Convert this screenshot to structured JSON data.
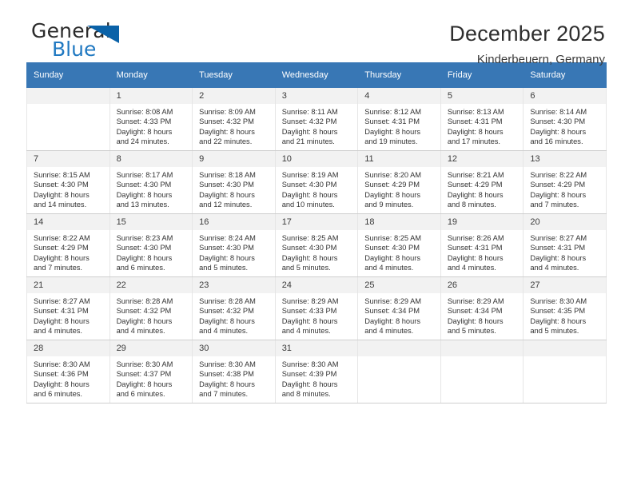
{
  "brand": {
    "name_top": "General",
    "name_bottom": "Blue",
    "triangle_color": "#0a62a8",
    "accent_color": "#1f78c1"
  },
  "header": {
    "title": "December 2025",
    "subtitle": "Kinderbeuern, Germany"
  },
  "calendar": {
    "header_bg": "#3877b5",
    "weekdays": [
      "Sunday",
      "Monday",
      "Tuesday",
      "Wednesday",
      "Thursday",
      "Friday",
      "Saturday"
    ],
    "weeks": [
      [
        {
          "day": "",
          "sunrise": "",
          "sunset": "",
          "daylight_1": "",
          "daylight_2": "",
          "empty": true
        },
        {
          "day": "1",
          "sunrise": "Sunrise: 8:08 AM",
          "sunset": "Sunset: 4:33 PM",
          "daylight_1": "Daylight: 8 hours",
          "daylight_2": "and 24 minutes."
        },
        {
          "day": "2",
          "sunrise": "Sunrise: 8:09 AM",
          "sunset": "Sunset: 4:32 PM",
          "daylight_1": "Daylight: 8 hours",
          "daylight_2": "and 22 minutes."
        },
        {
          "day": "3",
          "sunrise": "Sunrise: 8:11 AM",
          "sunset": "Sunset: 4:32 PM",
          "daylight_1": "Daylight: 8 hours",
          "daylight_2": "and 21 minutes."
        },
        {
          "day": "4",
          "sunrise": "Sunrise: 8:12 AM",
          "sunset": "Sunset: 4:31 PM",
          "daylight_1": "Daylight: 8 hours",
          "daylight_2": "and 19 minutes."
        },
        {
          "day": "5",
          "sunrise": "Sunrise: 8:13 AM",
          "sunset": "Sunset: 4:31 PM",
          "daylight_1": "Daylight: 8 hours",
          "daylight_2": "and 17 minutes."
        },
        {
          "day": "6",
          "sunrise": "Sunrise: 8:14 AM",
          "sunset": "Sunset: 4:30 PM",
          "daylight_1": "Daylight: 8 hours",
          "daylight_2": "and 16 minutes."
        }
      ],
      [
        {
          "day": "7",
          "sunrise": "Sunrise: 8:15 AM",
          "sunset": "Sunset: 4:30 PM",
          "daylight_1": "Daylight: 8 hours",
          "daylight_2": "and 14 minutes."
        },
        {
          "day": "8",
          "sunrise": "Sunrise: 8:17 AM",
          "sunset": "Sunset: 4:30 PM",
          "daylight_1": "Daylight: 8 hours",
          "daylight_2": "and 13 minutes."
        },
        {
          "day": "9",
          "sunrise": "Sunrise: 8:18 AM",
          "sunset": "Sunset: 4:30 PM",
          "daylight_1": "Daylight: 8 hours",
          "daylight_2": "and 12 minutes."
        },
        {
          "day": "10",
          "sunrise": "Sunrise: 8:19 AM",
          "sunset": "Sunset: 4:30 PM",
          "daylight_1": "Daylight: 8 hours",
          "daylight_2": "and 10 minutes."
        },
        {
          "day": "11",
          "sunrise": "Sunrise: 8:20 AM",
          "sunset": "Sunset: 4:29 PM",
          "daylight_1": "Daylight: 8 hours",
          "daylight_2": "and 9 minutes."
        },
        {
          "day": "12",
          "sunrise": "Sunrise: 8:21 AM",
          "sunset": "Sunset: 4:29 PM",
          "daylight_1": "Daylight: 8 hours",
          "daylight_2": "and 8 minutes."
        },
        {
          "day": "13",
          "sunrise": "Sunrise: 8:22 AM",
          "sunset": "Sunset: 4:29 PM",
          "daylight_1": "Daylight: 8 hours",
          "daylight_2": "and 7 minutes."
        }
      ],
      [
        {
          "day": "14",
          "sunrise": "Sunrise: 8:22 AM",
          "sunset": "Sunset: 4:29 PM",
          "daylight_1": "Daylight: 8 hours",
          "daylight_2": "and 7 minutes."
        },
        {
          "day": "15",
          "sunrise": "Sunrise: 8:23 AM",
          "sunset": "Sunset: 4:30 PM",
          "daylight_1": "Daylight: 8 hours",
          "daylight_2": "and 6 minutes."
        },
        {
          "day": "16",
          "sunrise": "Sunrise: 8:24 AM",
          "sunset": "Sunset: 4:30 PM",
          "daylight_1": "Daylight: 8 hours",
          "daylight_2": "and 5 minutes."
        },
        {
          "day": "17",
          "sunrise": "Sunrise: 8:25 AM",
          "sunset": "Sunset: 4:30 PM",
          "daylight_1": "Daylight: 8 hours",
          "daylight_2": "and 5 minutes."
        },
        {
          "day": "18",
          "sunrise": "Sunrise: 8:25 AM",
          "sunset": "Sunset: 4:30 PM",
          "daylight_1": "Daylight: 8 hours",
          "daylight_2": "and 4 minutes."
        },
        {
          "day": "19",
          "sunrise": "Sunrise: 8:26 AM",
          "sunset": "Sunset: 4:31 PM",
          "daylight_1": "Daylight: 8 hours",
          "daylight_2": "and 4 minutes."
        },
        {
          "day": "20",
          "sunrise": "Sunrise: 8:27 AM",
          "sunset": "Sunset: 4:31 PM",
          "daylight_1": "Daylight: 8 hours",
          "daylight_2": "and 4 minutes."
        }
      ],
      [
        {
          "day": "21",
          "sunrise": "Sunrise: 8:27 AM",
          "sunset": "Sunset: 4:31 PM",
          "daylight_1": "Daylight: 8 hours",
          "daylight_2": "and 4 minutes."
        },
        {
          "day": "22",
          "sunrise": "Sunrise: 8:28 AM",
          "sunset": "Sunset: 4:32 PM",
          "daylight_1": "Daylight: 8 hours",
          "daylight_2": "and 4 minutes."
        },
        {
          "day": "23",
          "sunrise": "Sunrise: 8:28 AM",
          "sunset": "Sunset: 4:32 PM",
          "daylight_1": "Daylight: 8 hours",
          "daylight_2": "and 4 minutes."
        },
        {
          "day": "24",
          "sunrise": "Sunrise: 8:29 AM",
          "sunset": "Sunset: 4:33 PM",
          "daylight_1": "Daylight: 8 hours",
          "daylight_2": "and 4 minutes."
        },
        {
          "day": "25",
          "sunrise": "Sunrise: 8:29 AM",
          "sunset": "Sunset: 4:34 PM",
          "daylight_1": "Daylight: 8 hours",
          "daylight_2": "and 4 minutes."
        },
        {
          "day": "26",
          "sunrise": "Sunrise: 8:29 AM",
          "sunset": "Sunset: 4:34 PM",
          "daylight_1": "Daylight: 8 hours",
          "daylight_2": "and 5 minutes."
        },
        {
          "day": "27",
          "sunrise": "Sunrise: 8:30 AM",
          "sunset": "Sunset: 4:35 PM",
          "daylight_1": "Daylight: 8 hours",
          "daylight_2": "and 5 minutes."
        }
      ],
      [
        {
          "day": "28",
          "sunrise": "Sunrise: 8:30 AM",
          "sunset": "Sunset: 4:36 PM",
          "daylight_1": "Daylight: 8 hours",
          "daylight_2": "and 6 minutes."
        },
        {
          "day": "29",
          "sunrise": "Sunrise: 8:30 AM",
          "sunset": "Sunset: 4:37 PM",
          "daylight_1": "Daylight: 8 hours",
          "daylight_2": "and 6 minutes."
        },
        {
          "day": "30",
          "sunrise": "Sunrise: 8:30 AM",
          "sunset": "Sunset: 4:38 PM",
          "daylight_1": "Daylight: 8 hours",
          "daylight_2": "and 7 minutes."
        },
        {
          "day": "31",
          "sunrise": "Sunrise: 8:30 AM",
          "sunset": "Sunset: 4:39 PM",
          "daylight_1": "Daylight: 8 hours",
          "daylight_2": "and 8 minutes."
        },
        {
          "day": "",
          "sunrise": "",
          "sunset": "",
          "daylight_1": "",
          "daylight_2": "",
          "empty": true
        },
        {
          "day": "",
          "sunrise": "",
          "sunset": "",
          "daylight_1": "",
          "daylight_2": "",
          "empty": true
        },
        {
          "day": "",
          "sunrise": "",
          "sunset": "",
          "daylight_1": "",
          "daylight_2": "",
          "empty": true
        }
      ]
    ]
  }
}
